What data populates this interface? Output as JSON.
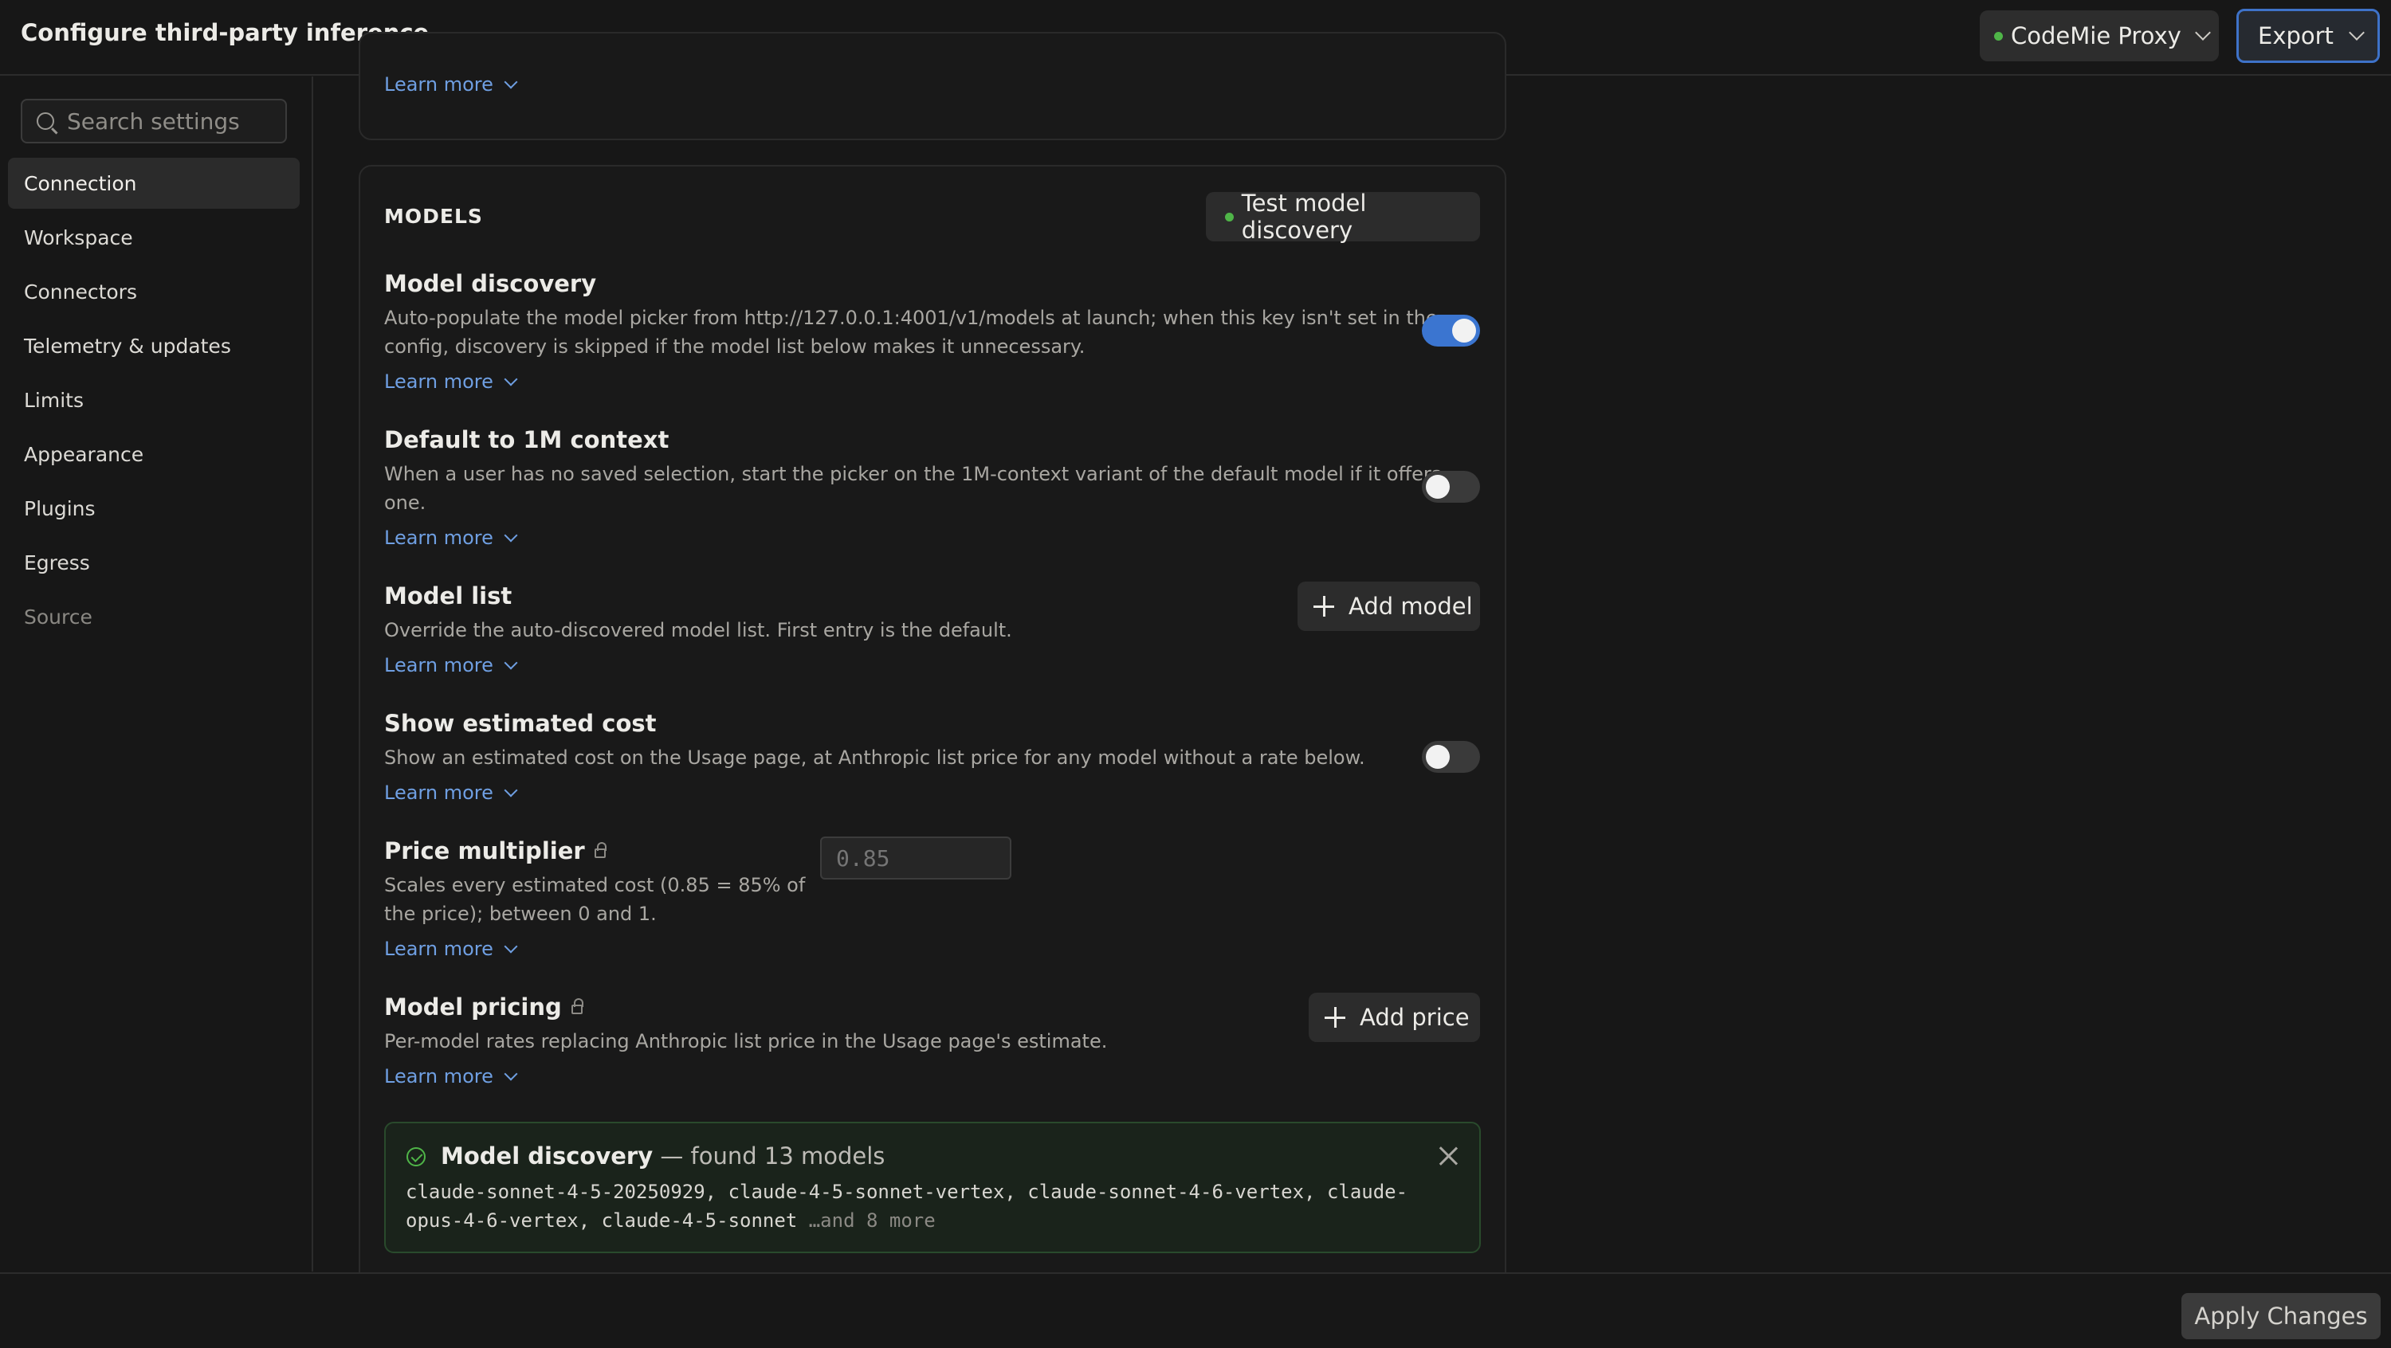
{
  "header": {
    "title": "Configure third-party inference",
    "profile": {
      "label": "CodeMie Proxy",
      "status_color": "#4fb548"
    },
    "export_label": "Export"
  },
  "sidebar": {
    "search_placeholder": "Search settings",
    "items": [
      {
        "label": "Connection",
        "active": true
      },
      {
        "label": "Workspace"
      },
      {
        "label": "Connectors"
      },
      {
        "label": "Telemetry & updates"
      },
      {
        "label": "Limits"
      },
      {
        "label": "Appearance"
      },
      {
        "label": "Plugins"
      },
      {
        "label": "Egress"
      },
      {
        "label": "Source",
        "muted": true
      }
    ]
  },
  "main": {
    "prev_card": {
      "learn_more": "Learn more"
    },
    "models": {
      "section_title": "MODELS",
      "test_button": "Test model discovery",
      "settings": {
        "model_discovery": {
          "title": "Model discovery",
          "desc_line1": "Auto-populate the model picker from http://127.0.0.1:4001/v1/models at launch; when this key isn't set in the",
          "desc_line2": "config, discovery is skipped if the model list below makes it unnecessary.",
          "learn_more": "Learn more",
          "enabled": true
        },
        "default_1m": {
          "title": "Default to 1M context",
          "desc_line1": "When a user has no saved selection, start the picker on the 1M-context variant of the default model if it offers",
          "desc_line2": "one.",
          "learn_more": "Learn more",
          "enabled": false
        },
        "model_list": {
          "title": "Model list",
          "desc": "Override the auto-discovered model list. First entry is the default.",
          "learn_more": "Learn more",
          "button": "Add model"
        },
        "show_cost": {
          "title": "Show estimated cost",
          "desc": "Show an estimated cost on the Usage page, at Anthropic list price for any model without a rate below.",
          "learn_more": "Learn more",
          "enabled": false
        },
        "price_multiplier": {
          "title": "Price multiplier",
          "desc_line1": "Scales every estimated cost (0.85 = 85% of",
          "desc_line2": "the price); between 0 and 1.",
          "learn_more": "Learn more",
          "placeholder": "0.85"
        },
        "model_pricing": {
          "title": "Model pricing",
          "desc": "Per-model rates replacing Anthropic list price in the Usage page's estimate.",
          "learn_more": "Learn more",
          "button": "Add price"
        }
      },
      "discovery_result": {
        "title": "Model discovery",
        "subtitle": " — found 13 models",
        "models_line1": "claude-sonnet-4-5-20250929, claude-4-5-sonnet-vertex, claude-sonnet-4-6-vertex, claude-",
        "models_line2": "opus-4-6-vertex, claude-4-5-sonnet",
        "more": " …and 8 more"
      }
    }
  },
  "footer": {
    "apply_label": "Apply Changes"
  },
  "colors": {
    "accent": "#3b75d0",
    "link": "#6f9fe2",
    "success": "#4fb548"
  }
}
